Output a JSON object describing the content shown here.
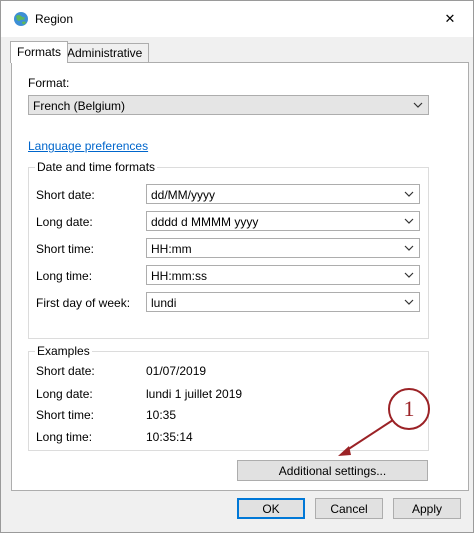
{
  "window": {
    "title": "Region",
    "close_glyph": "✕"
  },
  "tabs": [
    {
      "label": "Formats",
      "active": true
    },
    {
      "label": "Administrative",
      "active": false
    }
  ],
  "format": {
    "label": "Format:",
    "value": "French (Belgium)"
  },
  "language_link": "Language preferences",
  "date_time": {
    "title": "Date and time formats",
    "rows": [
      {
        "label": "Short date:",
        "value": "dd/MM/yyyy"
      },
      {
        "label": "Long date:",
        "value": "dddd d MMMM yyyy"
      },
      {
        "label": "Short time:",
        "value": "HH:mm"
      },
      {
        "label": "Long time:",
        "value": "HH:mm:ss"
      },
      {
        "label": "First day of week:",
        "value": "lundi"
      }
    ]
  },
  "examples": {
    "title": "Examples",
    "rows": [
      {
        "label": "Short date:",
        "value": "01/07/2019"
      },
      {
        "label": "Long date:",
        "value": "lundi 1 juillet 2019"
      },
      {
        "label": "Short time:",
        "value": "10:35"
      },
      {
        "label": "Long time:",
        "value": "10:35:14"
      }
    ]
  },
  "buttons": {
    "additional": "Additional settings...",
    "ok": "OK",
    "cancel": "Cancel",
    "apply": "Apply"
  },
  "annotation": {
    "number": "1",
    "color": "#9b2226"
  },
  "icons": {
    "title": "globe-icon",
    "dropdown": "chevron-down-icon",
    "close": "close-icon"
  }
}
